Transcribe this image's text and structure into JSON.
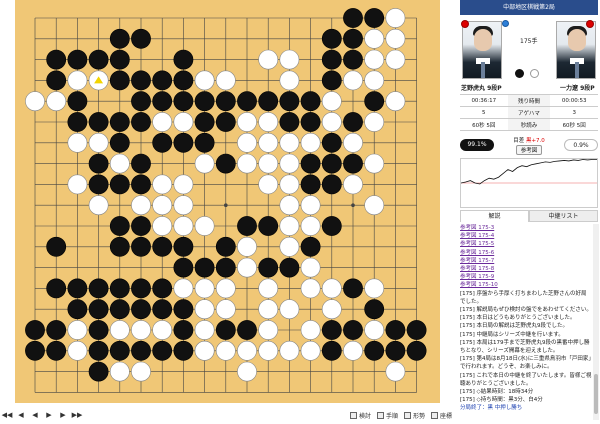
{
  "colors": {
    "board": "#f0c776",
    "grid": "#444444",
    "accent": "#2a4d8c",
    "black_rate": "#111111",
    "last_move_marker": "#f2d400"
  },
  "board": {
    "size": 19,
    "last_move": "D16",
    "coords_cols": "ABCDEFGHJKLMNOPQRST",
    "black": [
      "Q19",
      "R19",
      "E18",
      "F18",
      "P18",
      "Q18",
      "B17",
      "C17",
      "D17",
      "E17",
      "H17",
      "P17",
      "Q17",
      "B16",
      "E16",
      "F16",
      "G16",
      "H16",
      "P16",
      "C15",
      "F15",
      "G15",
      "H15",
      "J15",
      "K15",
      "L15",
      "M15",
      "N15",
      "O15",
      "R15",
      "C14",
      "D14",
      "E14",
      "F14",
      "J14",
      "K14",
      "N14",
      "O14",
      "Q14",
      "E13",
      "G13",
      "H13",
      "J13",
      "P13",
      "D12",
      "F12",
      "K12",
      "O12",
      "P12",
      "Q12",
      "D11",
      "E11",
      "F11",
      "O11",
      "P11",
      "E9",
      "F9",
      "L9",
      "M9",
      "P9",
      "B8",
      "E8",
      "F8",
      "G8",
      "H8",
      "K8",
      "O8",
      "H7",
      "J7",
      "K7",
      "M7",
      "N7",
      "B6",
      "C6",
      "D6",
      "E6",
      "F6",
      "G6",
      "Q6",
      "C5",
      "D5",
      "E5",
      "F5",
      "G5",
      "H5",
      "R5",
      "A4",
      "B4",
      "D4",
      "H4",
      "K4",
      "L4",
      "P4",
      "Q4",
      "S4",
      "T4",
      "A3",
      "B3",
      "D3",
      "E3",
      "F3",
      "G3",
      "H3",
      "P3",
      "R3",
      "S3",
      "T3",
      "D2"
    ],
    "white": [
      "S19",
      "R18",
      "S18",
      "M17",
      "N17",
      "R17",
      "S17",
      "C16",
      "D16",
      "I16",
      "J16",
      "K16",
      "N16",
      "Q16",
      "R16",
      "A15",
      "B15",
      "P15",
      "S15",
      "G14",
      "H14",
      "L14",
      "M14",
      "P14",
      "R14",
      "C13",
      "D13",
      "L13",
      "M13",
      "N13",
      "O13",
      "Q13",
      "E12",
      "J12",
      "L12",
      "M12",
      "N12",
      "R12",
      "C11",
      "G11",
      "H11",
      "M11",
      "N11",
      "Q11",
      "D10",
      "F10",
      "G10",
      "H10",
      "N10",
      "O10",
      "R10",
      "G9",
      "H9",
      "J9",
      "N9",
      "O9",
      "K8",
      "L8",
      "N8",
      "J7",
      "L7",
      "O7",
      "C6",
      "H6",
      "J6",
      "K6",
      "M6",
      "O6",
      "P6",
      "R6",
      "J5",
      "K5",
      "M5",
      "N5",
      "P5",
      "C4",
      "E4",
      "F4",
      "G4",
      "J4",
      "M4",
      "O4",
      "R4",
      "C3",
      "I3",
      "J3",
      "K3",
      "L3",
      "M3",
      "N3",
      "O3",
      "Q3",
      "E2",
      "F2",
      "L2",
      "S2"
    ]
  },
  "toolbar": {
    "nav": [
      "◀◀",
      "◀",
      "◀",
      "▶",
      "▶",
      "▶▶"
    ],
    "buttons": [
      "検討",
      "手順",
      "形勢",
      "座標"
    ]
  },
  "panel": {
    "match_title": "中部地区棋戦第2局",
    "move_label": "175手",
    "black_player": {
      "name": "芝野虎丸 9段P"
    },
    "white_player": {
      "name": "一力遼 9段P"
    },
    "stats": [
      [
        "00:36:17",
        "残り時間",
        "00:00:53"
      ],
      [
        "5",
        "アゲハマ",
        "3"
      ],
      [
        "60秒 5回",
        "秒読み",
        "60秒 5回"
      ]
    ],
    "winrate": {
      "black": "99.1%",
      "white": "0.9%",
      "score_label": "目差",
      "score_value": "黒+7.0",
      "ref_button": "参考図"
    },
    "tabs": [
      "解説",
      "中継リスト"
    ],
    "comments": {
      "refs": [
        "参考図 175-3",
        "参考図 175-4",
        "参考図 175-5",
        "参考図 175-6",
        "参考図 175-7",
        "参考図 175-8",
        "参考図 175-9",
        "参考図 175-10"
      ],
      "lines": [
        "[175] 序盤から手厚く打ちまわした芝野さんの好局でした。",
        "[175] 解説局もぜひ検討の盤でをあわせてください。",
        "[175] 本日はどうもありがとうございました。",
        "[175] 本日局の解説は芝野虎丸9段でした。",
        "[175] 中継局はシリーズ中継を行います。",
        "[175] 本局は179手まで芝野虎丸9段の黒番中押し勝ちとなり、シリーズ開幕を迎えました。",
        "[175] 第4局は8月18日(水)に三重県鳥羽市「戸田家」で行われます。どうぞ、お楽しみに。",
        "[175] これで本日の中継を終了いたします。皆様ご視聴ありがとうございました。",
        "[175] ◇結果時刻：18時34分",
        "[175] ◇持ち時間：黒3分、白4分"
      ],
      "last": "分局終了：黒 中押し勝ち"
    }
  },
  "graph_points": [
    0.5,
    0.52,
    0.55,
    0.5,
    0.48,
    0.55,
    0.6,
    0.58,
    0.62,
    0.7,
    0.78,
    0.74,
    0.82,
    0.86,
    0.84,
    0.88,
    0.9,
    0.92,
    0.94,
    0.93,
    0.95,
    0.96,
    0.97,
    0.96,
    0.98,
    0.97,
    0.99,
    0.98,
    0.99,
    0.99
  ]
}
